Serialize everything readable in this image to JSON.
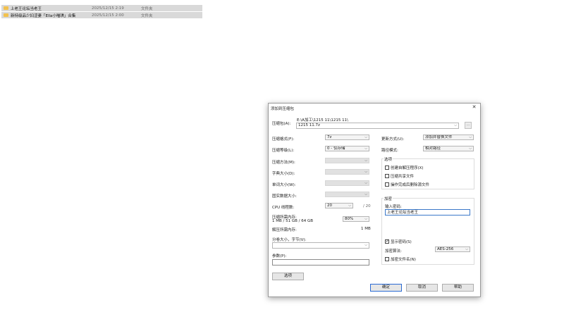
{
  "files": [
    {
      "name": "上老王论坛当老王",
      "date": "2025/12/15 2:19",
      "type": "文件夹"
    },
    {
      "name": "新特级品少妇涩妻「Ella小喵琪」合集",
      "date": "2025/12/15 2:00",
      "type": "文件夹"
    }
  ],
  "dialog": {
    "title": "添加到压缩包",
    "close": "✕",
    "archive_label": "压缩包(A):",
    "archive_path_hint": "E:\\A加工\\1215 11\\1215 11\\",
    "archive_value": "1215 11.7z",
    "browse": "...",
    "format_label": "压缩格式(F):",
    "format_value": "7z",
    "level_label": "压缩等级(L):",
    "level_value": "0 - 仅存储",
    "method_label": "压缩方法(M):",
    "dict_label": "字典大小(D):",
    "word_label": "单词大小(W):",
    "solid_label": "固实数据大小:",
    "threads_label": "CPU 线程数:",
    "threads_value": "20",
    "threads_max": "/ 20",
    "mem_comp_label": "压缩所需内存:",
    "mem_comp_detail": "1 MB / 51 GB / 64 GB",
    "mem_comp_value": "80%",
    "mem_decomp_label": "解压所需内存:",
    "mem_decomp_value": "1 MB",
    "split_label": "分卷大小，字节(V):",
    "params_label": "参数(P):",
    "options_button": "选项",
    "update_label": "更新方式(U):",
    "update_value": "添加并替换文件",
    "path_label": "路径模式:",
    "path_value": "相对路径",
    "options_group": "选项",
    "opt_sfx": "创建自解压程序(X)",
    "opt_shared": "压缩共享文件",
    "opt_delete": "操作完成后删除源文件",
    "encrypt_group": "加密",
    "pwd_label": "输入密码:",
    "pwd_value": "上老王论坛当老王",
    "show_pwd": "显示密码(S)",
    "enc_method_label": "加密算法:",
    "enc_method_value": "AES-256",
    "enc_names": "加密文件名(N)",
    "ok": "确定",
    "cancel": "取消",
    "help": "帮助"
  }
}
